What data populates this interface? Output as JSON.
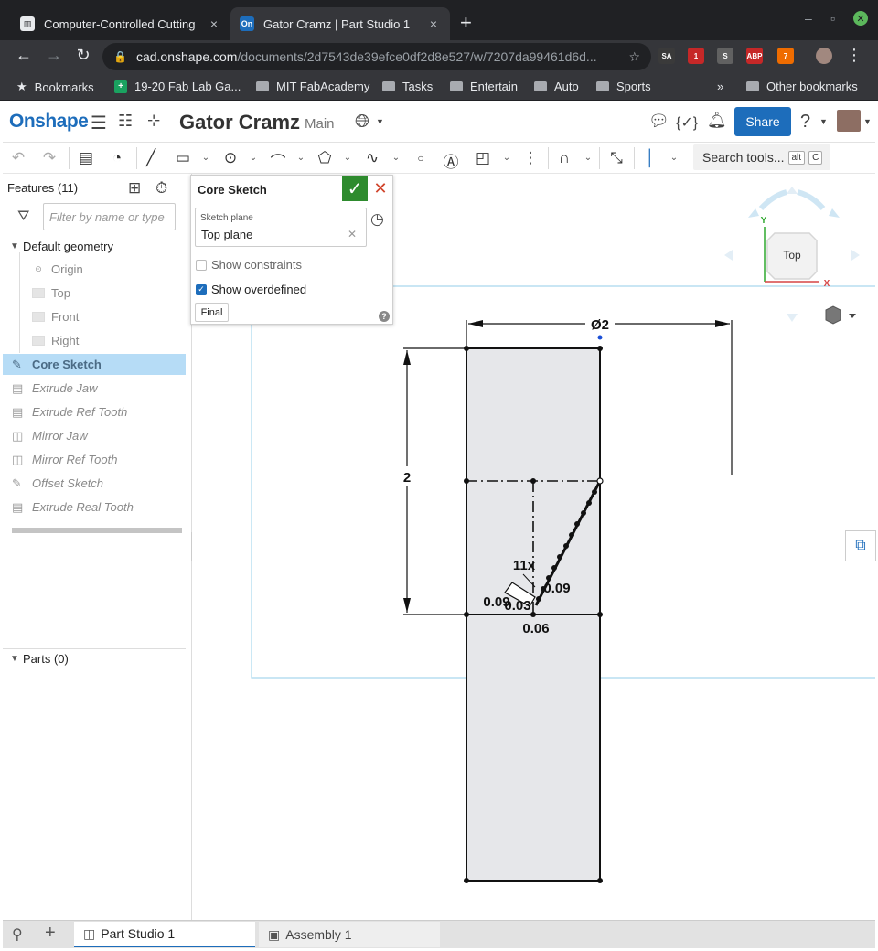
{
  "browser": {
    "tabs": [
      {
        "title": "Computer-Controlled Cutting",
        "favicon": "fab-icon",
        "close": "×"
      },
      {
        "title": "Gator Cramz | Part Studio 1",
        "favicon": "On",
        "close": "×"
      }
    ],
    "new_tab": "+",
    "url_host": "cad.onshape.com",
    "url_path": "/documents/2d7543de39efce0df2d8e527/w/7207da99461d6d...",
    "extensions": [
      {
        "label": "SA",
        "color": "#3a3a3a"
      },
      {
        "label": "1",
        "color": "#c62828"
      },
      {
        "label": "S",
        "color": "#616161"
      },
      {
        "label": "ABP",
        "color": "#c62828"
      },
      {
        "label": "7",
        "color": "#ef6c00"
      }
    ],
    "bookmarks": [
      "Bookmarks",
      "19-20 Fab Lab Ga...",
      "MIT FabAcademy",
      "Tasks",
      "Entertain",
      "Auto",
      "Sports"
    ],
    "bookmarks_more": "»",
    "other_bookmarks": "Other bookmarks"
  },
  "app": {
    "logo": "Onshape",
    "doc_title": "Gator Cramz",
    "branch": "Main",
    "share": "Share",
    "search_tools": "Search tools...",
    "search_kbd_1": "alt",
    "search_kbd_2": "C"
  },
  "features": {
    "title": "Features (11)",
    "filter_placeholder": "Filter by name or type",
    "default_geometry": "Default geometry",
    "default_items": [
      "Origin",
      "Top",
      "Front",
      "Right"
    ],
    "items": [
      {
        "label": "Core Sketch",
        "icon": "sketch-icon",
        "selected": true
      },
      {
        "label": "Extrude Jaw",
        "icon": "extrude-icon"
      },
      {
        "label": "Extrude Ref Tooth",
        "icon": "extrude-icon"
      },
      {
        "label": "Mirror Jaw",
        "icon": "mirror-icon"
      },
      {
        "label": "Mirror Ref Tooth",
        "icon": "mirror-icon"
      },
      {
        "label": "Offset Sketch",
        "icon": "sketch-icon"
      },
      {
        "label": "Extrude Real Tooth",
        "icon": "extrude-icon"
      }
    ],
    "parts": "Parts (0)"
  },
  "sketch_dialog": {
    "title": "Core Sketch",
    "plane_label": "Sketch plane",
    "plane_value": "Top plane",
    "show_constraints": "Show constraints",
    "show_overdefined": "Show overdefined",
    "show_constraints_checked": false,
    "show_overdefined_checked": true,
    "final": "Final",
    "help": "?"
  },
  "viewcube": {
    "face": "Top",
    "axis_x": "X",
    "axis_y": "Y"
  },
  "dimensions": {
    "width": "Ø2",
    "height": "2",
    "pattern": "11x",
    "d1": "0.09",
    "d2": "0.09",
    "d3": "0.03",
    "d4": "0.06"
  },
  "bottom_tabs": [
    "Part Studio 1",
    "Assembly 1"
  ],
  "colors": {
    "accent": "#1d6dbb",
    "ok": "#2e8b2e",
    "cancel": "#d0432a",
    "selection": "#b6dcf6"
  }
}
